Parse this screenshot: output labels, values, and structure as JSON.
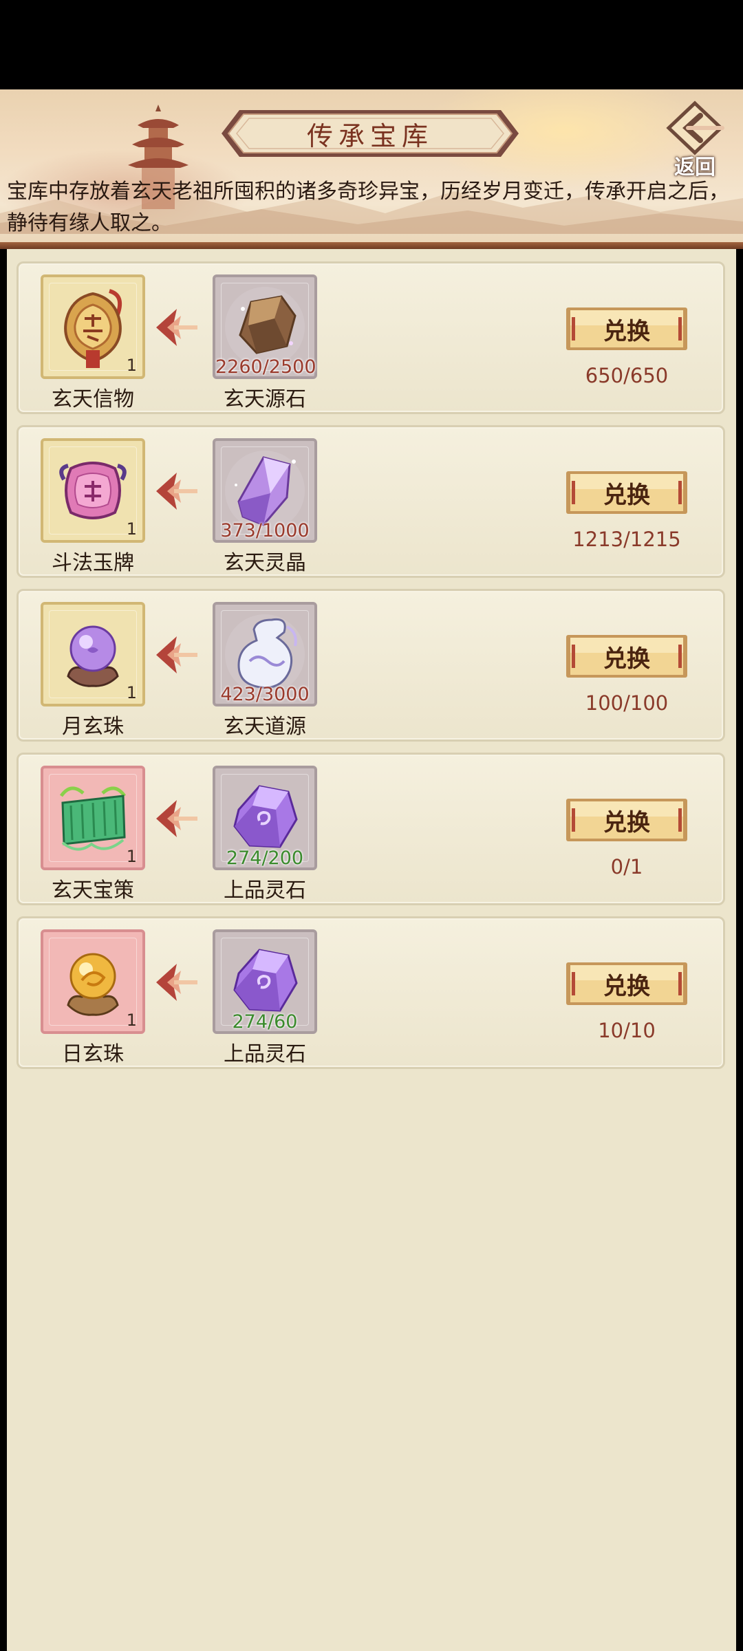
{
  "header": {
    "title": "传承宝库",
    "back_label": "返回",
    "intro": "宝库中存放着玄天老祖所囤积的诸多奇珍异宝，历经岁月变迁，传承开启之后，静待有缘人取之。"
  },
  "rows": [
    {
      "reward": {
        "name": "玄天信物",
        "qty": "1",
        "icon": "xuantian-token-icon",
        "frame": "yellow"
      },
      "cost": {
        "name": "玄天源石",
        "count": "2260/2500",
        "icon": "brown-ore-icon",
        "sufficient": false
      },
      "button": "兑换",
      "limit": "650/650"
    },
    {
      "reward": {
        "name": "斗法玉牌",
        "qty": "1",
        "icon": "jade-tablet-icon",
        "frame": "yellow"
      },
      "cost": {
        "name": "玄天灵晶",
        "count": "373/1000",
        "icon": "purple-crystal-icon",
        "sufficient": false
      },
      "button": "兑换",
      "limit": "1213/1215"
    },
    {
      "reward": {
        "name": "月玄珠",
        "qty": "1",
        "icon": "moon-pearl-icon",
        "frame": "yellow"
      },
      "cost": {
        "name": "玄天道源",
        "count": "423/3000",
        "icon": "spirit-vase-icon",
        "sufficient": false
      },
      "button": "兑换",
      "limit": "100/100"
    },
    {
      "reward": {
        "name": "玄天宝策",
        "qty": "1",
        "icon": "green-scroll-icon",
        "frame": "pink"
      },
      "cost": {
        "name": "上品灵石",
        "count": "274/200",
        "icon": "spirit-stone-icon",
        "sufficient": true
      },
      "button": "兑换",
      "limit": "0/1"
    },
    {
      "reward": {
        "name": "日玄珠",
        "qty": "1",
        "icon": "sun-pearl-icon",
        "frame": "pink"
      },
      "cost": {
        "name": "上品灵石",
        "count": "274/60",
        "icon": "spirit-stone-icon",
        "sufficient": true
      },
      "button": "兑换",
      "limit": "10/10"
    }
  ],
  "colors": {
    "title_text": "#7a3220",
    "count_insufficient": "#9a3a2c",
    "count_sufficient": "#3a8a2c",
    "limit_text": "#8a3a2a"
  }
}
